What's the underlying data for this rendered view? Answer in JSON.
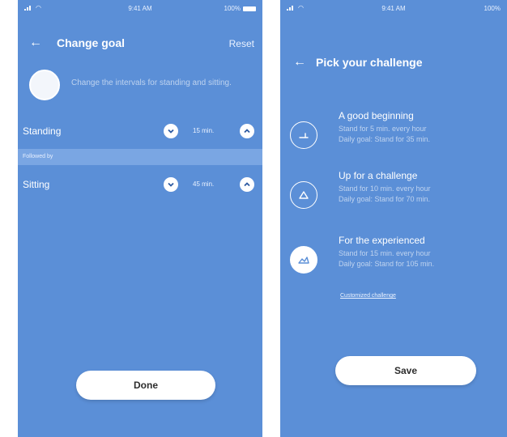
{
  "colors": {
    "screen_bg": "#5b8fd7",
    "followed_band": "#7aa6e3",
    "button_bg": "#ffffff",
    "button_text": "#2d2d2d",
    "chevron": "#2d5aa1"
  },
  "left_screen": {
    "status": {
      "time": "9:41 AM",
      "battery": "100%"
    },
    "header": {
      "back_icon": "←",
      "title": "Change goal",
      "reset_label": "Reset"
    },
    "goal": {
      "description": "Change the intervals for standing and sitting."
    },
    "standing": {
      "label": "Standing",
      "value": "15 min."
    },
    "followed_by": "Followed by",
    "sitting": {
      "label": "Sitting",
      "value": "45 min."
    },
    "done_label": "Done"
  },
  "right_screen": {
    "status": {
      "time": "9:41 AM",
      "battery": "100%"
    },
    "header": {
      "back_icon": "←",
      "title": "Pick your challenge"
    },
    "challenges": [
      {
        "icon": "seat-icon",
        "title": "A good beginning",
        "line1": "Stand for 5 min. every hour",
        "line2": "Daily goal: Stand for 35 min."
      },
      {
        "icon": "slope-icon",
        "title": "Up for a challenge",
        "line1": "Stand for 10 min. every hour",
        "line2": "Daily goal: Stand for 70 min."
      },
      {
        "icon": "mountain-icon",
        "title": "For the experienced",
        "line1": "Stand for 15 min. every hour",
        "line2": "Daily goal: Stand for 105 min."
      }
    ],
    "custom_link": "Customized challenge",
    "save_label": "Save"
  }
}
